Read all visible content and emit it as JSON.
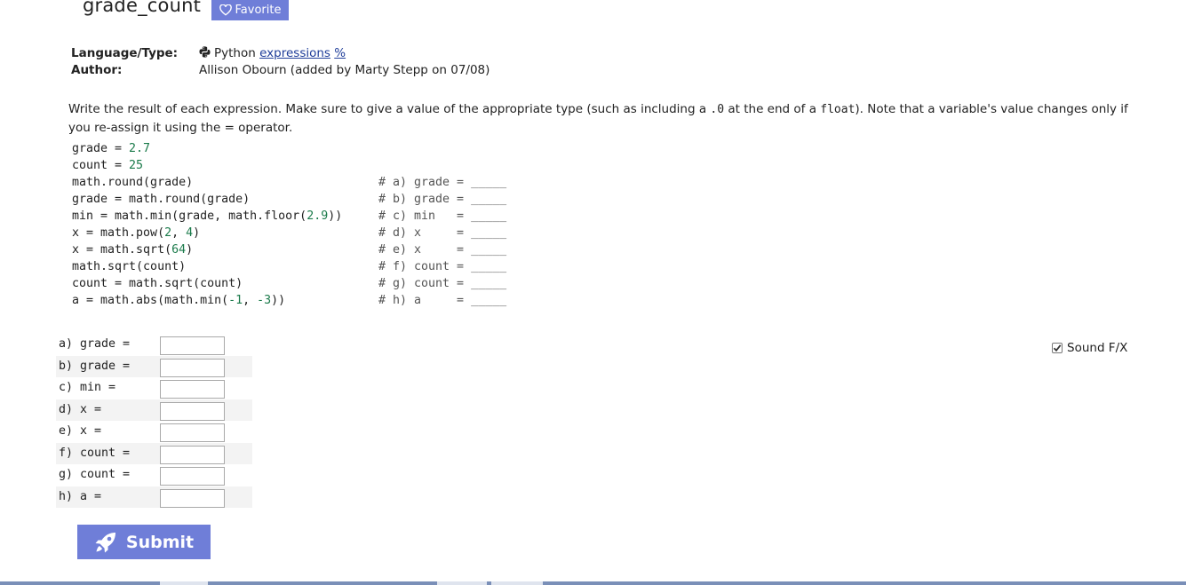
{
  "problem": {
    "title": "grade_count",
    "favorite_label": "Favorite"
  },
  "meta": {
    "language_label": "Language/Type:",
    "language_name": "Python",
    "language_link1": "expressions",
    "language_link2": "%",
    "author_label": "Author:",
    "author_value": "Allison Obourn (added by Marty Stepp on 07/08)"
  },
  "description": {
    "part1": "Write the result of each expression. Make sure to give a value of the appropriate type (such as including a ",
    "code1": ".0",
    "part2": " at the end of a ",
    "code2": "float",
    "part3": "). Note that a variable's value changes only if you re-assign it using the = operator."
  },
  "code_lines": [
    {
      "code": "grade = 2.7",
      "comment": ""
    },
    {
      "code": "count = 25",
      "comment": ""
    },
    {
      "code": "math.round(grade)",
      "comment": "# a) grade = _____"
    },
    {
      "code": "grade = math.round(grade)",
      "comment": "# b) grade = _____"
    },
    {
      "code": "min = math.min(grade, math.floor(2.9))",
      "comment": "# c) min   = _____"
    },
    {
      "code": "x = math.pow(2, 4)",
      "comment": "# d) x     = _____"
    },
    {
      "code": "x = math.sqrt(64)",
      "comment": "# e) x     = _____"
    },
    {
      "code": "math.sqrt(count)",
      "comment": "# f) count = _____"
    },
    {
      "code": "count = math.sqrt(count)",
      "comment": "# g) count = _____"
    },
    {
      "code": "a = math.abs(math.min(-1, -3))",
      "comment": "# h) a     = _____"
    }
  ],
  "answers": [
    {
      "label": "a) grade =",
      "value": ""
    },
    {
      "label": "b) grade =",
      "value": ""
    },
    {
      "label": "c) min =",
      "value": ""
    },
    {
      "label": "d) x =",
      "value": ""
    },
    {
      "label": "e) x =",
      "value": ""
    },
    {
      "label": "f) count =",
      "value": ""
    },
    {
      "label": "g) count =",
      "value": ""
    },
    {
      "label": "h) a =",
      "value": ""
    }
  ],
  "sound_label": "Sound F/X",
  "sound_checked": true,
  "submit_label": "Submit",
  "colors": {
    "accent": "#6f7ed8",
    "number": "#1a7a4a",
    "link": "#1f3d99"
  }
}
